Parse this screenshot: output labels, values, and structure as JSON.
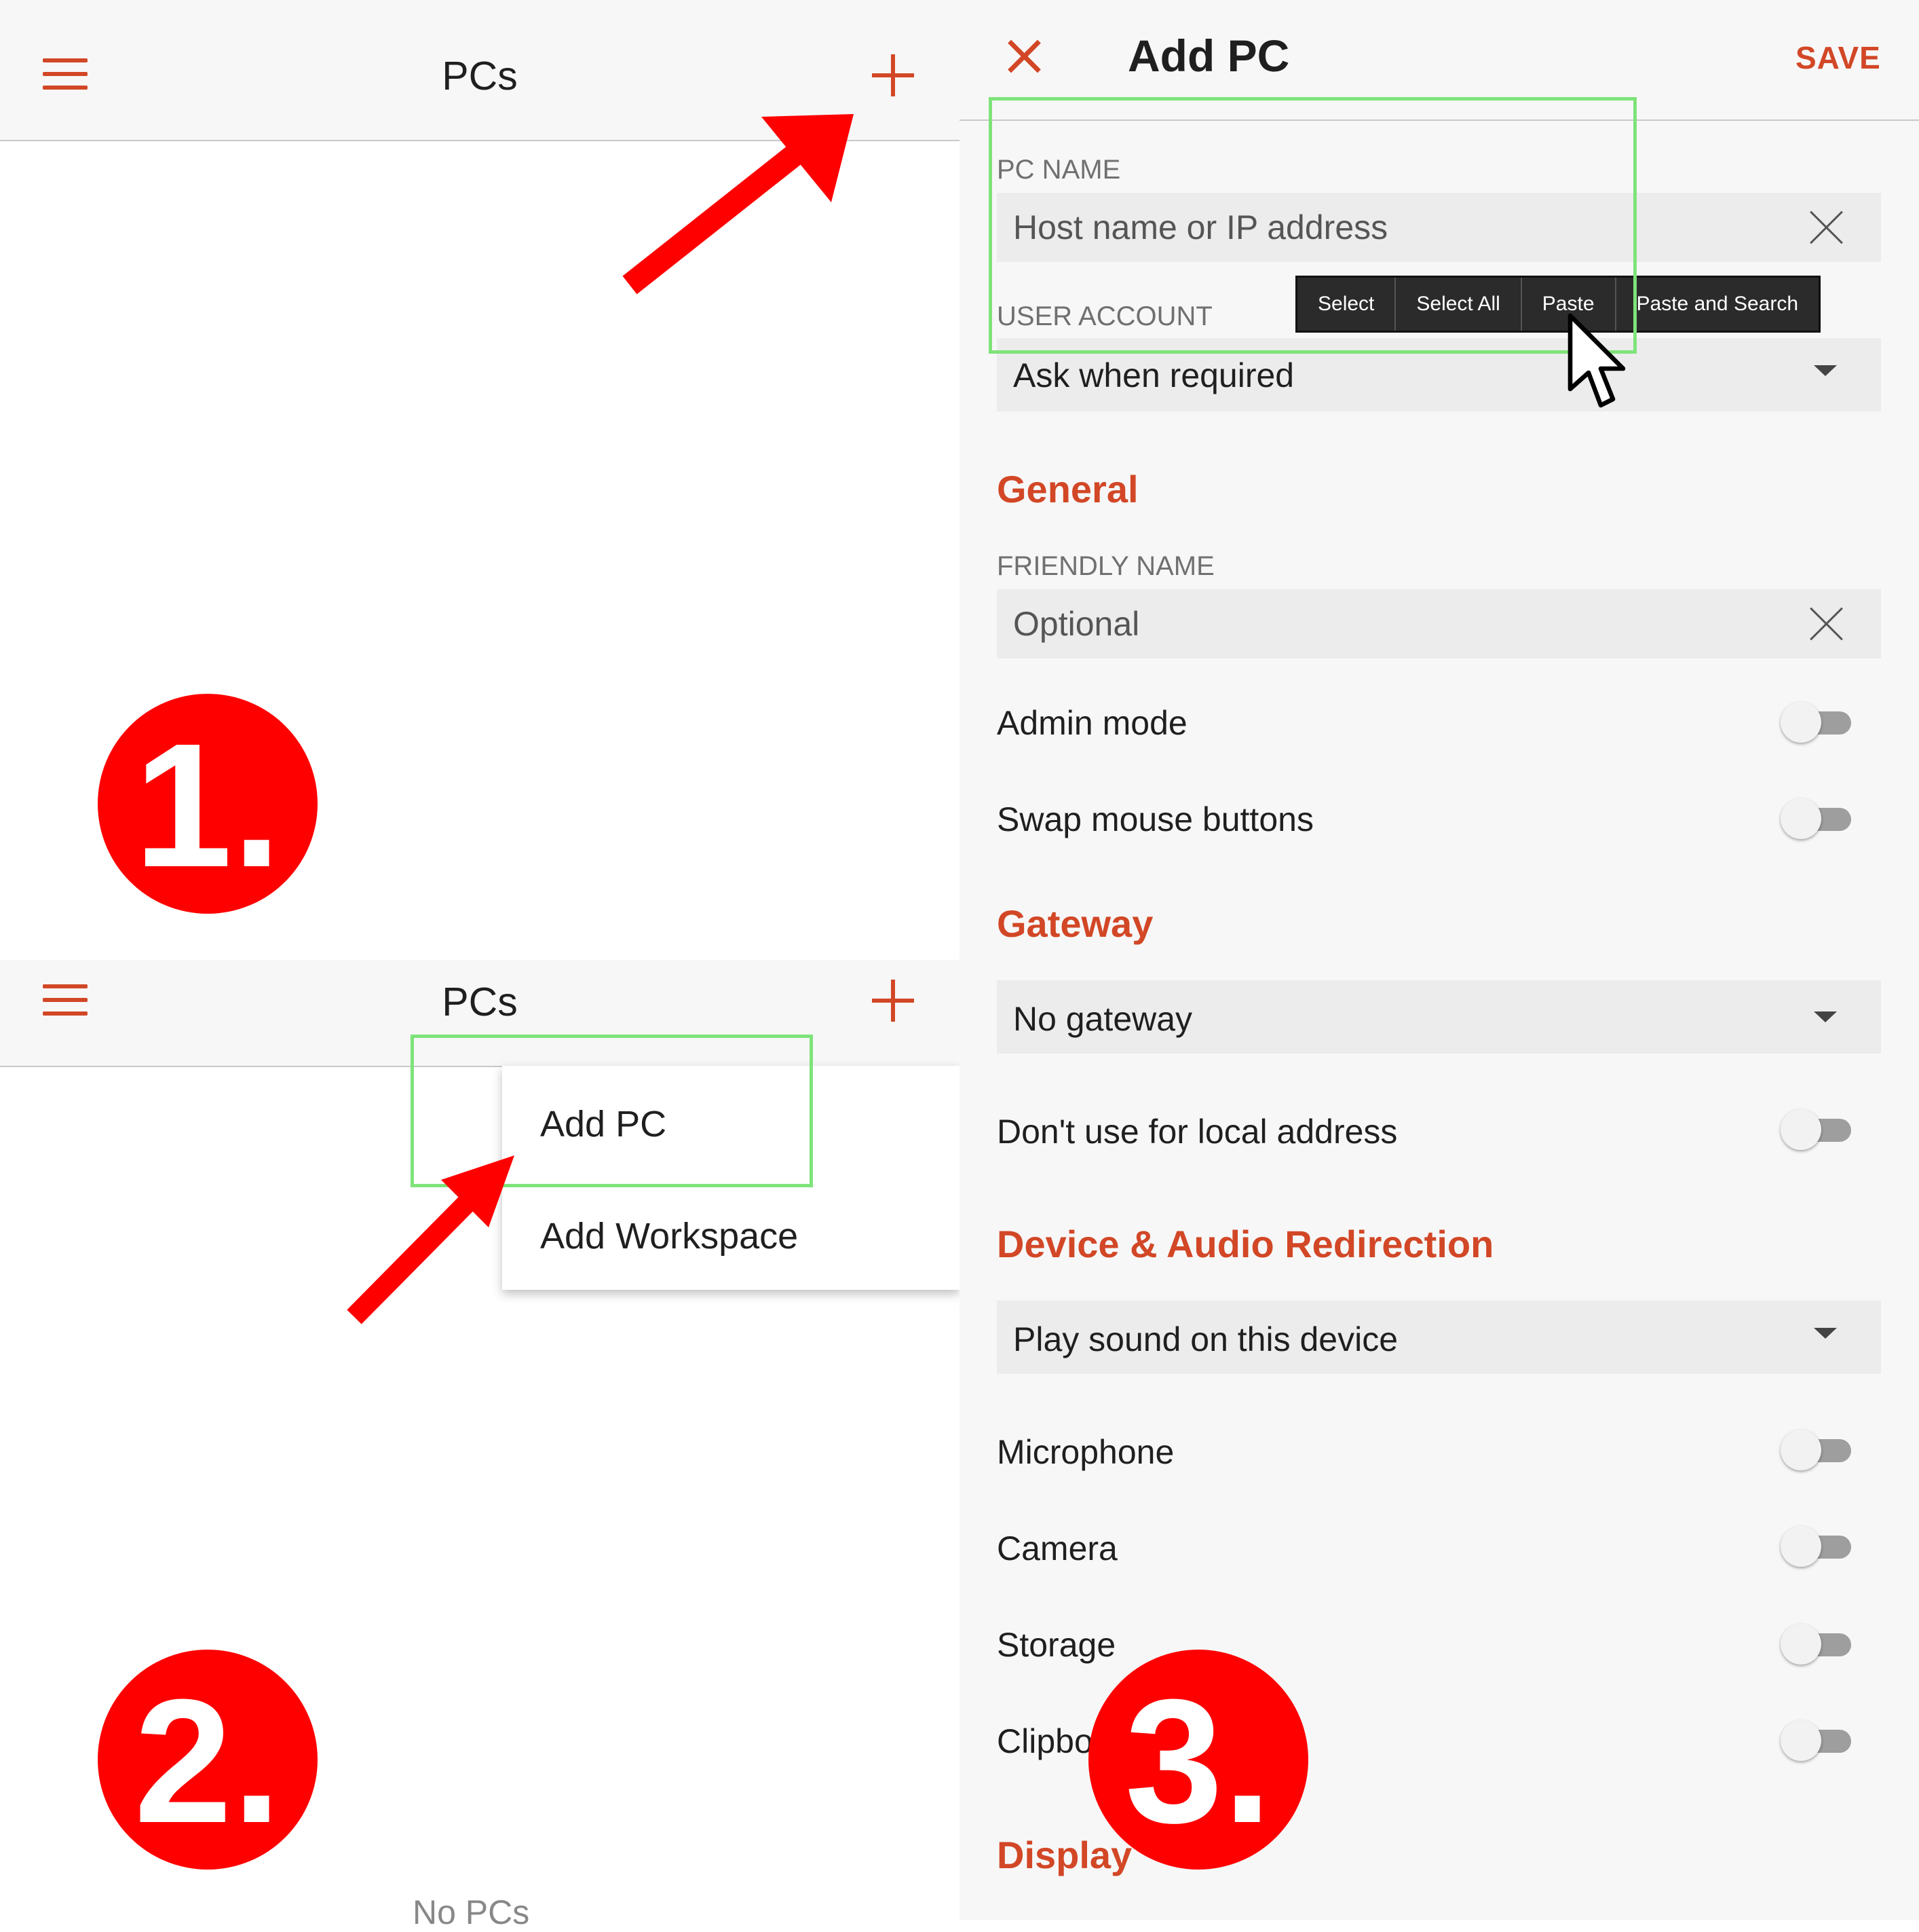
{
  "panel1": {
    "title": "PCs",
    "badge": "1."
  },
  "panel2": {
    "title": "PCs",
    "menu": {
      "items": [
        "Add PC",
        "Add Workspace"
      ]
    },
    "empty_text": "No PCs",
    "badge": "2."
  },
  "panel3": {
    "title": "Add PC",
    "save_label": "SAVE",
    "pc_name": {
      "label": "PC NAME",
      "placeholder": "Host name or IP address"
    },
    "user_account": {
      "label": "USER ACCOUNT",
      "value": "Ask when required"
    },
    "context_menu": [
      "Select",
      "Select All",
      "Paste",
      "Paste and Search"
    ],
    "general": {
      "heading": "General",
      "friendly_name": {
        "label": "FRIENDLY NAME",
        "placeholder": "Optional"
      },
      "admin_mode": "Admin mode",
      "swap_mouse": "Swap mouse buttons"
    },
    "gateway": {
      "heading": "Gateway",
      "value": "No gateway",
      "local_address": "Don't use for local address"
    },
    "device_audio": {
      "heading": "Device & Audio Redirection",
      "sound_value": "Play sound on this device",
      "microphone": "Microphone",
      "camera": "Camera",
      "storage": "Storage",
      "clipboard": "Clipbo"
    },
    "display": {
      "heading": "Display"
    },
    "badge": "3."
  },
  "colors": {
    "accent": "#d24726",
    "annotation_red": "#ff0000",
    "highlight_green": "#7ee37a"
  }
}
